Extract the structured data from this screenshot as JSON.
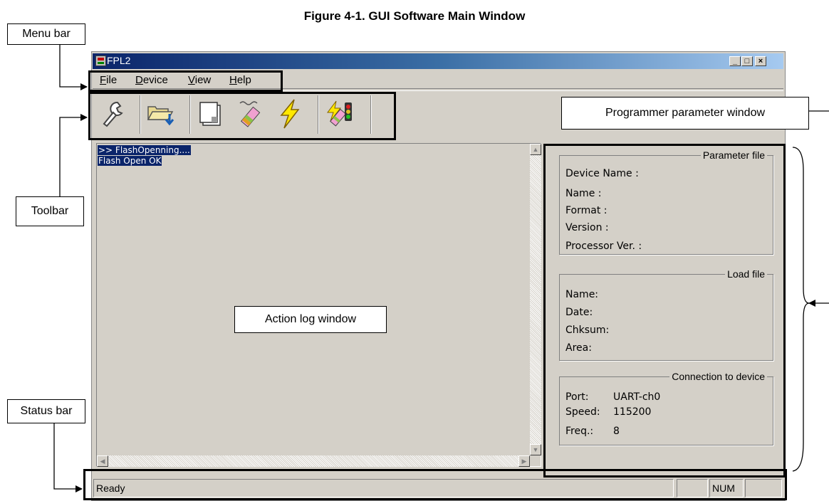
{
  "figure": {
    "title": "Figure 4-1.  GUI Software Main Window"
  },
  "callouts": {
    "menu_bar": "Menu bar",
    "toolbar": "Toolbar",
    "status_bar": "Status bar",
    "action_log": "Action log window",
    "programmer_param": "Programmer parameter window"
  },
  "window": {
    "title": "FPL2",
    "controls": {
      "minimize": "_",
      "maximize": "□",
      "close": "×"
    }
  },
  "menu": [
    {
      "label": "File"
    },
    {
      "label": "Device"
    },
    {
      "label": "View"
    },
    {
      "label": "Help"
    }
  ],
  "toolbar": {
    "buttons": [
      "setup-wrench-icon",
      "open-file-icon",
      "blank-page-icon",
      "program-pen-icon",
      "lightning-icon",
      "autoprocedure-icon"
    ]
  },
  "log": {
    "lines": [
      ">> FlashOpenning....",
      "Flash Open OK"
    ]
  },
  "parameter_file": {
    "title": "Parameter file",
    "device_name": "Device Name :",
    "name": "Name :",
    "format": "Format :",
    "version": "Version :",
    "processor_ver": "Processor Ver. :"
  },
  "load_file": {
    "title": "Load file",
    "name": "Name:",
    "date": "Date:",
    "chksum": "Chksum:",
    "area": "Area:"
  },
  "connection": {
    "title": "Connection to device",
    "port_label": "Port:",
    "port_value": "UART-ch0",
    "speed_label": "Speed:",
    "speed_value": "115200",
    "freq_label": "Freq.:",
    "freq_value": "8"
  },
  "status": {
    "text": "Ready",
    "num": "NUM"
  },
  "colors": {
    "face": "#d4d0c8",
    "title_gradient_start": "#0a246a",
    "title_gradient_end": "#a6caf0",
    "log_highlight": "#0a246a"
  }
}
